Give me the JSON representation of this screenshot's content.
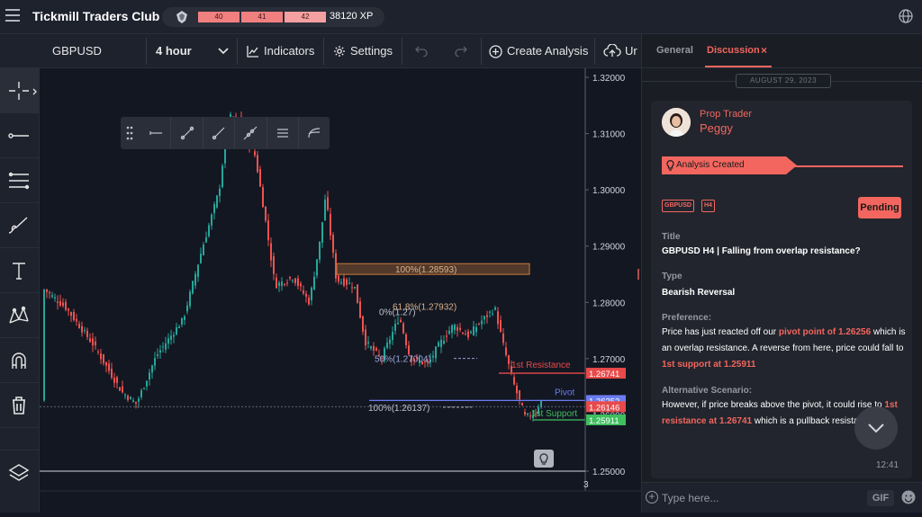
{
  "app": {
    "title": "Tickmill Traders Club",
    "xp_segments": [
      "40",
      "41",
      "42"
    ],
    "xp_value": "38120 XP",
    "xp_progress": 0.6
  },
  "toolbar": {
    "symbol": "GBPUSD",
    "interval": "4 hour",
    "indicators": "Indicators",
    "settings": "Settings",
    "create_analysis": "Create Analysis",
    "upload_partial": "Ur"
  },
  "left_tools": [
    "crosshair-icon",
    "trend-line-icon",
    "fib-icon",
    "brush-icon",
    "text-icon",
    "pattern-icon",
    "magnet-icon",
    "trash-icon",
    "layers-icon"
  ],
  "float_toolbar": [
    "drag-handle-icon",
    "horizontal-ray-icon",
    "segment-icon",
    "ray-icon",
    "extended-line-icon",
    "parallel-channel-icon",
    "curve-icon"
  ],
  "chart_data": {
    "type": "candlestick",
    "symbol": "GBPUSD",
    "interval": "4 hour",
    "price_axis_ticks": [
      "1.32000",
      "1.31000",
      "1.30000",
      "1.29000",
      "1.28000",
      "1.27000",
      "1.26000",
      "1.25000"
    ],
    "ylim": [
      1.25,
      1.32
    ],
    "time_axis_labels": [
      "3"
    ],
    "levels": [
      {
        "name": "1st Resistance",
        "price": 1.26741,
        "label": "1.26741",
        "color": "#e84a4a"
      },
      {
        "name": "Pivot",
        "price": 1.26256,
        "label": "1.26252",
        "color": "#6b7cf2"
      },
      {
        "name": "current",
        "price": 1.26146,
        "label": "1.26146",
        "color": "#e84a4a"
      },
      {
        "name": "1st Support",
        "price": 1.25911,
        "label": "1.25911",
        "color": "#3fbf5f"
      }
    ],
    "annotations": [
      "100%(1.28593)",
      "61.8%(1.27932)",
      "0%(1.27)",
      "50%(1.27004)",
      "100%(1.26137)",
      "1st Resistance",
      "Pivot",
      "1st Support"
    ],
    "colors": {
      "up": "#26a69a",
      "down": "#ef5350"
    }
  },
  "panel": {
    "tabs": [
      "General",
      "Discussion"
    ],
    "close_glyph": "×",
    "date": "AUGUST 29, 2023",
    "role": "Prop Trader",
    "user": "Peggy",
    "banner": "Analysis Created",
    "tags": [
      "GBPUSD",
      "H4"
    ],
    "status": "Pending",
    "title_label": "Title",
    "title_value": "GBPUSD H4 | Falling from overlap resistance?",
    "type_label": "Type",
    "type_value": "Bearish Reversal",
    "pref_label": "Preference:",
    "pref_1": "Price has just reacted off our ",
    "pref_hl1": "pivot point of 1.26256",
    "pref_2": " which is an overlap resistance. A reverse from here, price could fall to ",
    "pref_hl2": "1st support at 1.25911",
    "alt_label": "Alternative Scenario:",
    "alt_1": "However, if price breaks above the pivot, it could rise to ",
    "alt_hl1": "1st resistance at 1.26741",
    "alt_2": " which is a pullback resistance",
    "time": "12:41",
    "input_placeholder": "Type here...",
    "gif_label": "GIF"
  },
  "accent": "#f2665f"
}
